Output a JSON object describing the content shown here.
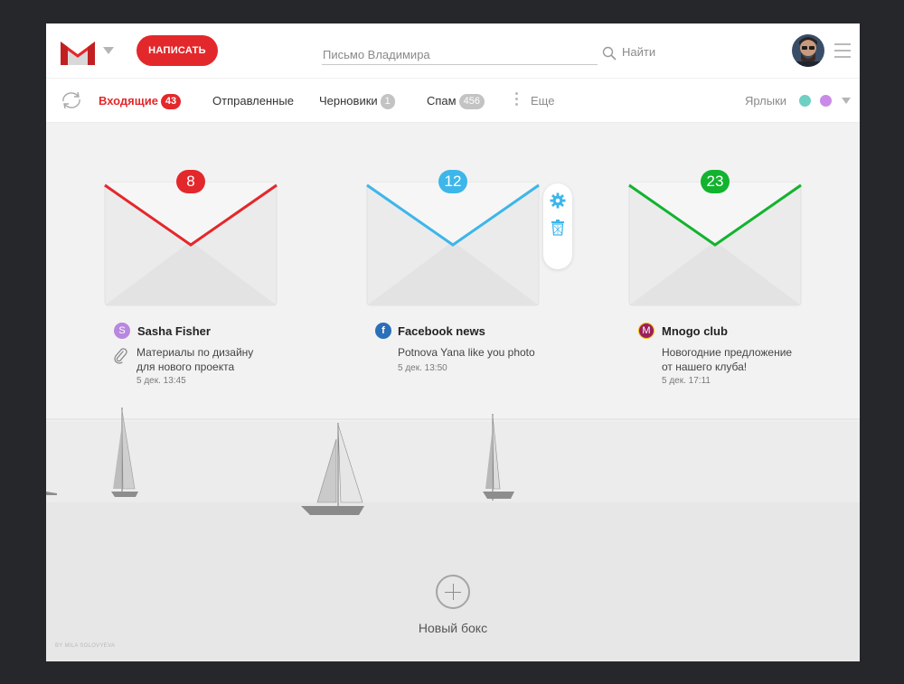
{
  "header": {
    "compose_label": "НАПИСАТЬ",
    "search_placeholder": "Письмо Владимира",
    "search_label": "Найти",
    "logo_icon": "gmail-m-icon"
  },
  "nav": {
    "inbox_label": "Входящие",
    "inbox_count": "43",
    "sent_label": "Отправленные",
    "drafts_label": "Черновики",
    "drafts_count": "1",
    "spam_label": "Спам",
    "spam_count": "456",
    "more_label": "Еще",
    "labels_label": "Ярлыки",
    "label_colors": [
      "#6fcfc4",
      "#c98be8"
    ]
  },
  "boxes": [
    {
      "count": "8",
      "color": "#e3282c",
      "sender": "Sasha Fisher",
      "sender_icon": "S",
      "sender_icon_color": "#b887df",
      "message": [
        "Материалы по дизайну",
        "для нового проекта"
      ],
      "date": "5 дек. 13:45",
      "attachment": true
    },
    {
      "count": "12",
      "color": "#3db6ea",
      "sender": "Facebook news",
      "sender_icon": "f",
      "sender_icon_color": "#2a70b8",
      "message": [
        "Potnova Yana like you photo"
      ],
      "date": "5 дек. 13:50",
      "attachment": false
    },
    {
      "count": "23",
      "color": "#12b32e",
      "sender": "Mnogo club",
      "sender_icon": "M",
      "sender_icon_color": "#9b1f5e",
      "message": [
        "Новогодние предложение",
        "от нашего клуба!"
      ],
      "date": "5 дек. 17:11",
      "attachment": false
    }
  ],
  "new_box_label": "Новый бокс",
  "credit": "BY MILA SOLOVYEVA",
  "colors": {
    "accent": "#e3282c",
    "settings_blue": "#3db6ea"
  }
}
